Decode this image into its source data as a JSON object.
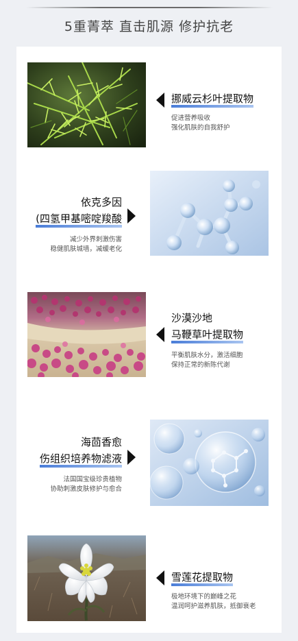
{
  "header": {
    "title": "5重菁萃 直击肌源 修护抗老"
  },
  "items": [
    {
      "title_lines": [
        "挪威云杉叶提取物"
      ],
      "desc_lines": [
        "促进营养吸收",
        "强化肌肤的自我舒护"
      ]
    },
    {
      "title_lines": [
        "依克多因",
        "(四氢甲基嘧啶羧酸"
      ],
      "desc_lines": [
        "减少外界刺激伤害",
        "稳健肌肤城墙，减缓老化"
      ]
    },
    {
      "title_lines": [
        "沙漠沙地",
        "马鞭草叶提取物"
      ],
      "desc_lines": [
        "平衡肌肤水分，激活细胞",
        "保持正常的新陈代谢"
      ]
    },
    {
      "title_lines": [
        "海茴香愈",
        "伤组织培养物滤液"
      ],
      "desc_lines": [
        "法国国宝级珍贵植物",
        "协助刺激皮肤修护与愈合"
      ]
    },
    {
      "title_lines": [
        "雪莲花提取物"
      ],
      "desc_lines": [
        "极地环境下的巅峰之花",
        "温润呵护滋养肌肤，抵御衰老"
      ]
    }
  ]
}
